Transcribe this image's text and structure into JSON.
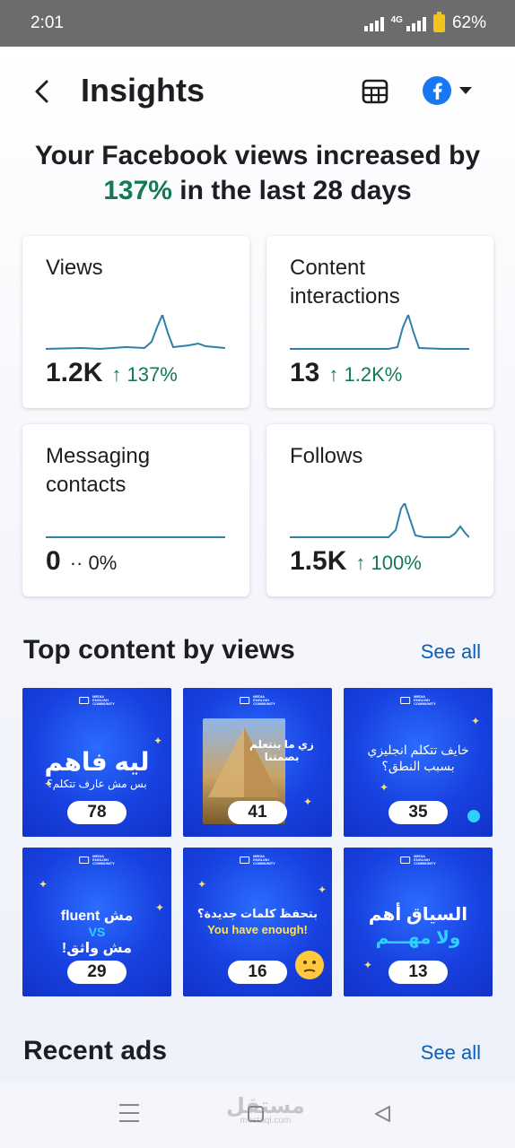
{
  "status_bar": {
    "time": "2:01",
    "network": "4G",
    "battery": "62%"
  },
  "header": {
    "title": "Insights",
    "back_icon": "chevron-left-icon",
    "table_icon": "table-grid-icon",
    "account_icon": "facebook-icon",
    "dropdown_icon": "caret-down-icon"
  },
  "headline": {
    "prefix": "Your Facebook views increased by ",
    "percent": "137%",
    "suffix": " in the last 28 days"
  },
  "cards": [
    {
      "label": "Views",
      "value": "1.2K",
      "arrow": "↑",
      "delta": "137%"
    },
    {
      "label": "Content interactions",
      "value": "13",
      "arrow": "↑",
      "delta": "1.2K%"
    },
    {
      "label": "Messaging contacts",
      "value": "0",
      "arrow": "··",
      "delta": "0%"
    },
    {
      "label": "Follows",
      "value": "1.5K",
      "arrow": "↑",
      "delta": "100%"
    }
  ],
  "top_content": {
    "title": "Top content by views",
    "see_all": "See all",
    "items": [
      {
        "views": "78",
        "caption": "ليه فاهم",
        "sub": "بس مش عارف تتكلم؟"
      },
      {
        "views": "41",
        "caption": "زي ما بنتعلم بصمتنا",
        "sub": ""
      },
      {
        "views": "35",
        "caption": "خايف تتكلم انجليزي بسبب النطق؟",
        "sub": ""
      },
      {
        "views": "29",
        "caption": "مش fluent",
        "sub": "VS",
        "sub2": "مش واثق!"
      },
      {
        "views": "16",
        "caption": "بتحفظ كلمات جديدة؟",
        "sub": "You have enough!"
      },
      {
        "views": "13",
        "caption": "السياق أهم",
        "sub": "ولا مهـــم"
      }
    ]
  },
  "recent_ads": {
    "title": "Recent ads",
    "see_all": "See all"
  },
  "watermark": {
    "text": "مستقل",
    "sub": "mostaql.com"
  },
  "colors": {
    "accent_green": "#127a54",
    "link_blue": "#0a5fb4",
    "spark_blue": "#2f7fa8",
    "thumb_blue": "#1841e0"
  }
}
